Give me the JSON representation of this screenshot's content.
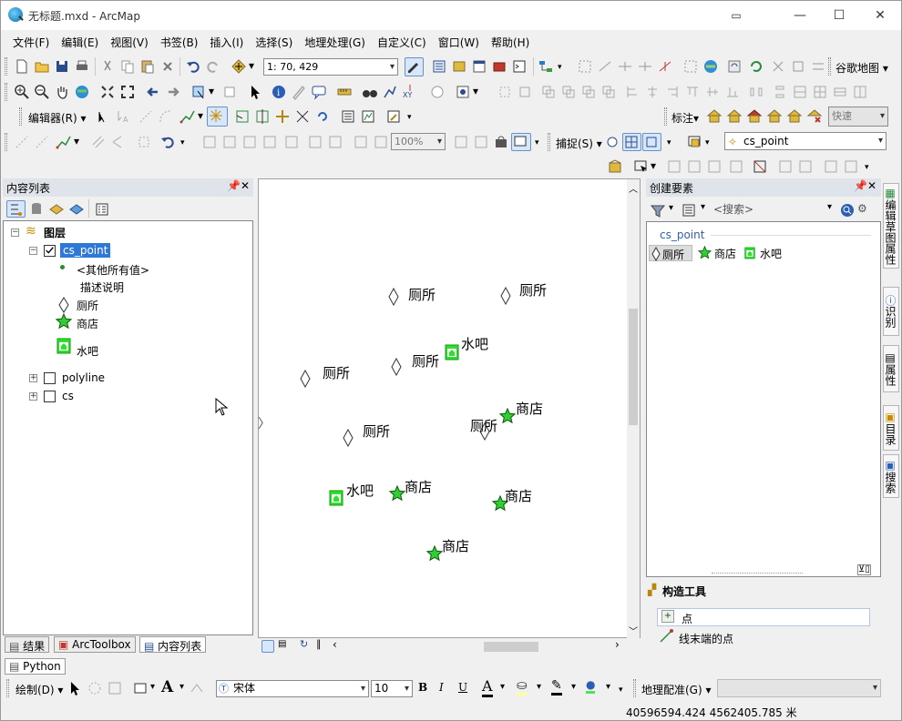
{
  "window": {
    "title": "无标题.mxd - ArcMap"
  },
  "menu": [
    "文件(F)",
    "编辑(E)",
    "视图(V)",
    "书签(B)",
    "插入(I)",
    "选择(S)",
    "地理处理(G)",
    "自定义(C)",
    "窗口(W)",
    "帮助(H)"
  ],
  "toolbar": {
    "scale": "1: 70, 429",
    "basemap_label": "谷歌地图",
    "editor_label": "编辑器(R)",
    "annotation_label": "标注",
    "speed_label": "快速",
    "zoom_percent": "100%",
    "snap_label": "捕捉(S)",
    "target_layer": "cs_point"
  },
  "toc": {
    "title": "内容列表",
    "root": "图层",
    "layers": [
      {
        "name": "cs_point",
        "checked": true
      },
      {
        "name": "polyline",
        "checked": false
      },
      {
        "name": "cs",
        "checked": false
      }
    ],
    "legend": {
      "other": "<其他所有值>",
      "desc": "描述说明",
      "items": [
        "厕所",
        "商店",
        "水吧"
      ]
    },
    "tabs": [
      "结果",
      "ArcToolbox",
      "内容列表"
    ]
  },
  "map": {
    "features": [
      {
        "type": "toilet",
        "label": "厕所"
      },
      {
        "type": "toilet",
        "label": "厕所"
      },
      {
        "type": "toilet",
        "label": "厕所"
      },
      {
        "type": "toilet",
        "label": "厕所"
      },
      {
        "type": "toilet",
        "label": "厕所"
      },
      {
        "type": "toilet",
        "label": "厕所"
      },
      {
        "type": "bar",
        "label": "水吧"
      },
      {
        "type": "bar",
        "label": "水吧"
      },
      {
        "type": "shop",
        "label": "商店"
      },
      {
        "type": "shop",
        "label": "商店"
      },
      {
        "type": "shop",
        "label": "商店"
      },
      {
        "type": "shop",
        "label": "商店"
      }
    ]
  },
  "create_features": {
    "title": "创建要素",
    "search_placeholder": "<搜索>",
    "layer": "cs_point",
    "templates": [
      "厕所",
      "商店",
      "水吧"
    ],
    "construct_title": "构造工具",
    "tools": [
      "点",
      "线末端的点"
    ]
  },
  "right_tabs": [
    "编辑草图属性",
    "识别",
    "属性",
    "目录",
    "搜索"
  ],
  "python_tab": "Python",
  "draw": {
    "label": "绘制(D)",
    "font": "宋体",
    "size": "10"
  },
  "georef_label": "地理配准(G)",
  "status": {
    "coords": "40596594.424  4562405.785 米"
  }
}
